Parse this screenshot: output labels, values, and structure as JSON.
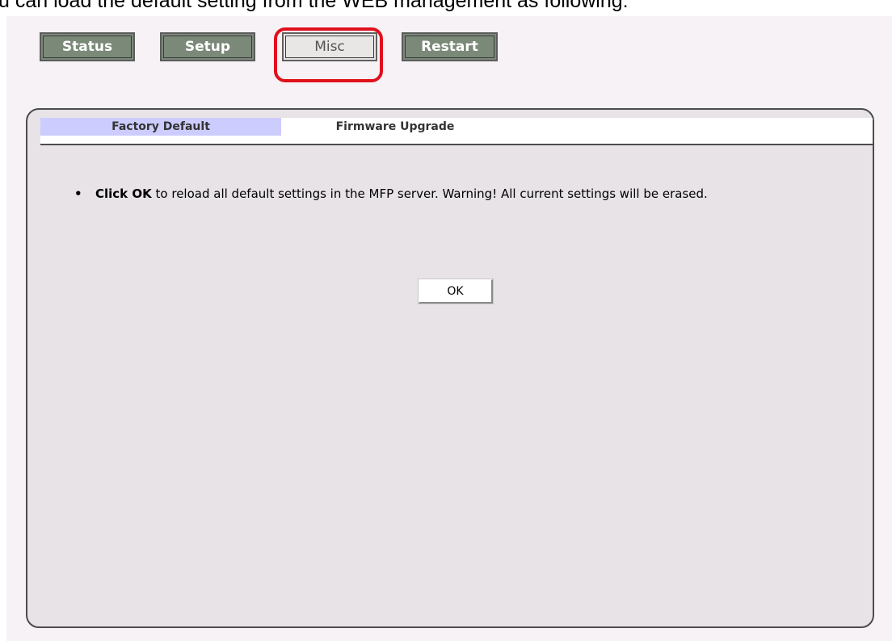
{
  "intro": {
    "text": "u can load the default setting from the WEB management as following:"
  },
  "nav": {
    "status_label": "Status",
    "setup_label": "Setup",
    "misc_label": "Misc",
    "restart_label": "Restart",
    "active": "Misc"
  },
  "tabs": [
    {
      "label": "Factory Default",
      "active": true
    },
    {
      "label": "Firmware Upgrade",
      "active": false
    }
  ],
  "content": {
    "bold_lead": "Click OK",
    "body_text": " to reload all default settings in the MFP server. Warning! All current settings will be erased.",
    "ok_label": "OK"
  },
  "colors": {
    "nav_button": "#7b8979",
    "active_tab": "#ccccff",
    "highlight": "#e0101c",
    "panel_bg": "#e7e3e7"
  }
}
